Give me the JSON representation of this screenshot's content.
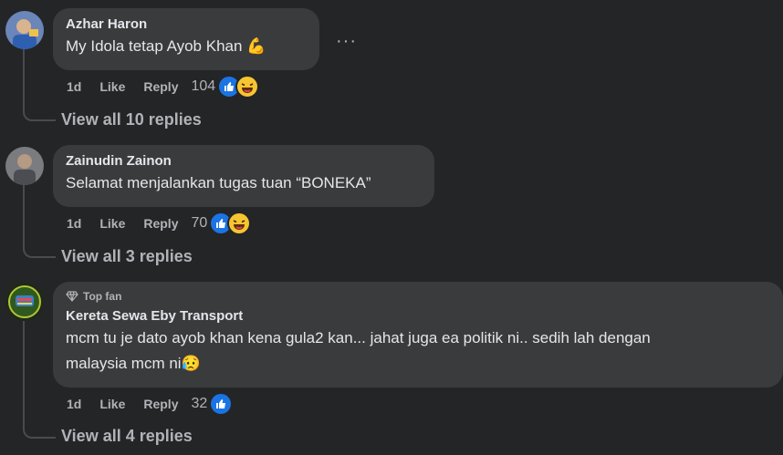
{
  "comments": [
    {
      "author": "Azhar Haron",
      "text": "My Idola tetap Ayob Khan 💪",
      "time": "1d",
      "like_label": "Like",
      "reply_label": "Reply",
      "reaction_count": "104",
      "reaction_icons": [
        "like-icon",
        "haha-icon"
      ],
      "view_replies": "View all 10 replies"
    },
    {
      "author": "Zainudin Zainon",
      "text": "Selamat menjalankan tugas tuan “BONEKA”",
      "time": "1d",
      "like_label": "Like",
      "reply_label": "Reply",
      "reaction_count": "70",
      "reaction_icons": [
        "like-icon",
        "haha-icon"
      ],
      "view_replies": "View all 3 replies"
    },
    {
      "badge": "Top fan",
      "author": "Kereta Sewa Eby Transport",
      "text_line1": "mcm tu je dato ayob khan kena gula2 kan... jahat juga ea politik ni.. sedih lah dengan",
      "text_line2": "malaysia mcm ni😥",
      "time": "1d",
      "like_label": "Like",
      "reply_label": "Reply",
      "reaction_count": "32",
      "reaction_icons": [
        "like-icon"
      ],
      "view_replies": "View all 4 replies"
    }
  ],
  "more_menu": "···",
  "colors": {
    "background": "#242526",
    "bubble": "#3a3b3c",
    "like_blue": "#1b74e4",
    "haha_yellow": "#f7c531"
  }
}
